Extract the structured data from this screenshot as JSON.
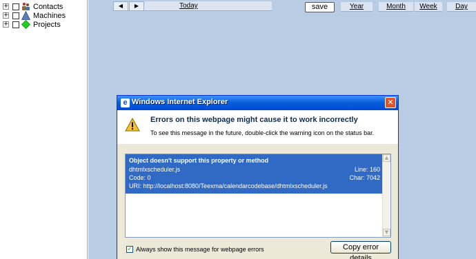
{
  "tree": {
    "items": [
      {
        "label": "Contacts",
        "expander": "+"
      },
      {
        "label": "Machines",
        "expander": "+"
      },
      {
        "label": "Projects",
        "expander": "+"
      }
    ]
  },
  "scheduler": {
    "prev_glyph": "◀",
    "next_glyph": "▶",
    "today_label": "Today",
    "save_label": "save",
    "views": [
      "Year",
      "Month",
      "Week",
      "Day"
    ]
  },
  "dialog": {
    "title": "Windows Internet Explorer",
    "title_icon": "e",
    "close_glyph": "✕",
    "heading": "Errors on this webpage might cause it to work incorrectly",
    "subtext": "To see this message in the future, double-click the warning icon on the status bar.",
    "error": {
      "message": "Object doesn't support this property or method",
      "file": "dhtmlxscheduler.js",
      "line": "Line: 160",
      "code": "Code: 0",
      "char": "Char: 7042",
      "uri": "URI: http://localhost:8080/Teexma/calendarcodebase/dhtmlxscheduler.js"
    },
    "always_show_label": "Always show this message for webpage errors",
    "always_show_checked": "✓",
    "copy_label": "Copy error details"
  },
  "colors": {
    "scheduler_bg": "#b8cce4",
    "selection": "#316ac5",
    "titlebar": "#0a5fdc",
    "dialog_bg": "#ece9d8"
  }
}
